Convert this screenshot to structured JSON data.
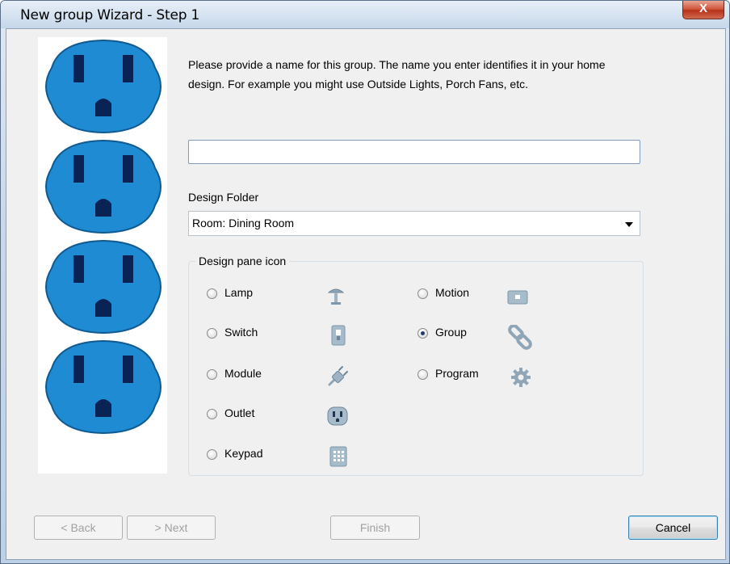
{
  "window": {
    "title": "New group Wizard - Step 1",
    "close_label": "X"
  },
  "prompt": {
    "line1": "Please provide a name for this group.  The name you enter identifies it in your home",
    "line2": "design.  For example you might use Outside Lights, Porch Fans, etc."
  },
  "name_field": {
    "value": "",
    "placeholder": ""
  },
  "design_folder": {
    "label": "Design Folder",
    "selected": "Room: Dining Room"
  },
  "icon_group": {
    "legend": "Design pane icon",
    "options": [
      {
        "label": "Lamp",
        "icon": "lamp-icon",
        "checked": false
      },
      {
        "label": "Switch",
        "icon": "switch-icon",
        "checked": false
      },
      {
        "label": "Module",
        "icon": "plug-icon",
        "checked": false
      },
      {
        "label": "Outlet",
        "icon": "outlet-icon",
        "checked": false
      },
      {
        "label": "Keypad",
        "icon": "keypad-icon",
        "checked": false
      },
      {
        "label": "Motion",
        "icon": "motion-sensor-icon",
        "checked": false
      },
      {
        "label": "Group",
        "icon": "chain-link-icon",
        "checked": true
      },
      {
        "label": "Program",
        "icon": "gear-icon",
        "checked": false
      }
    ]
  },
  "buttons": {
    "back": "< Back",
    "next": "> Next",
    "finish": "Finish",
    "cancel": "Cancel"
  },
  "colors": {
    "outlet_blue": "#1e8fd6",
    "outlet_dark": "#0b2354",
    "close_red": "#c8462d"
  }
}
